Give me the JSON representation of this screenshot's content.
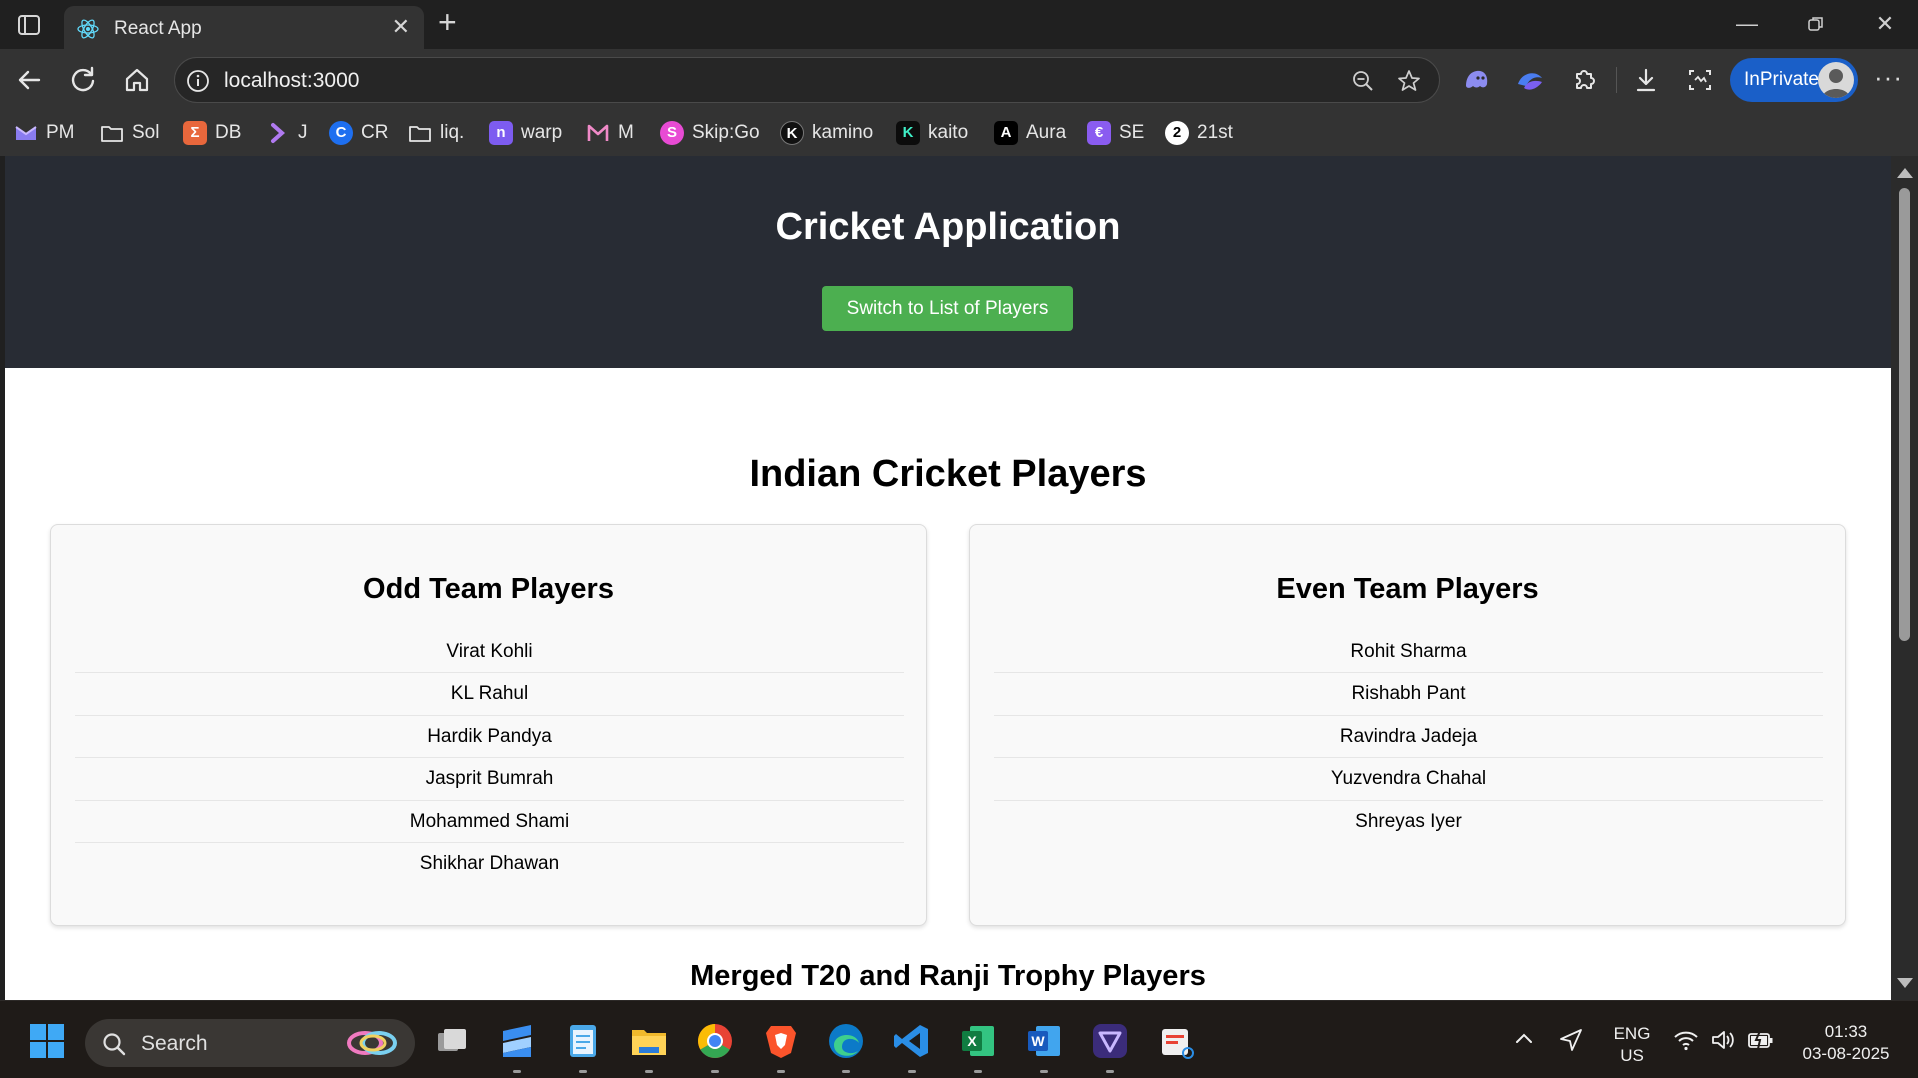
{
  "browser": {
    "tab_title": "React App",
    "url": "localhost:3000",
    "profile_label": "InPrivate",
    "bookmarks": [
      "PM",
      "Sol",
      "DB",
      "J",
      "CR",
      "liq.",
      "warp",
      "M",
      "Skip:Go",
      "kamino",
      "kaito",
      "Aura",
      "SE",
      "21st"
    ]
  },
  "app": {
    "title": "Cricket Application",
    "switch_button_label": "Switch to List of Players",
    "section_title": "Indian Cricket Players",
    "odd_team": {
      "title": "Odd Team Players",
      "players": [
        "Virat Kohli",
        "KL Rahul",
        "Hardik Pandya",
        "Jasprit Bumrah",
        "Mohammed Shami",
        "Shikhar Dhawan"
      ]
    },
    "even_team": {
      "title": "Even Team Players",
      "players": [
        "Rohit Sharma",
        "Rishabh Pant",
        "Ravindra Jadeja",
        "Yuzvendra Chahal",
        "Shreyas Iyer"
      ]
    },
    "merged_title": "Merged T20 and Ranji Trophy Players"
  },
  "taskbar": {
    "search_label": "Search",
    "language_line1": "ENG",
    "language_line2": "US",
    "time": "01:33",
    "date": "03-08-2025"
  },
  "colors": {
    "header_bg": "#282c34",
    "button_green": "#4caf50",
    "inprivate_blue": "#1a5fc8"
  }
}
